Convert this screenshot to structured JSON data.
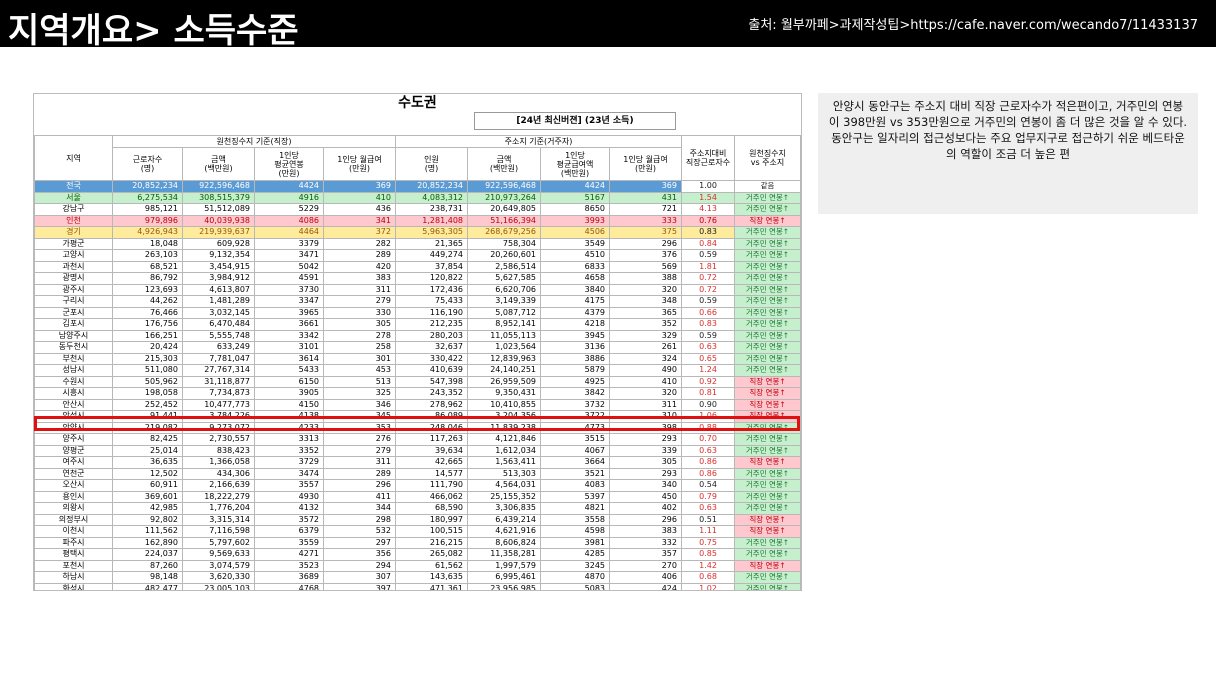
{
  "header": {
    "title": "지역개요> 소득수준",
    "source": "출처: 월부까페>과제작성팁>https://cafe.naver.com/wecando7/11433137"
  },
  "sheet": {
    "title": "수도권",
    "badge": "[24년 최신버젼] (23년 소득)",
    "group_withholding": "원천징수지 기준(직장)",
    "group_address": "주소지 기준(거주자)",
    "col_region": "지역",
    "col_workers": "근로자수\n(명)",
    "col_amount": "금액\n(백만원)",
    "col_avg": "1인당\n평균연봉\n(만원)",
    "col_monthly": "1인당 월급여\n(만원)",
    "col_people": "인원\n(명)",
    "col_amount2": "금액\n(백만원)",
    "col_avg2": "1인당\n평균급여액\n(백만원)",
    "col_monthly2": "1인당 월급여\n(만원)",
    "col_ratio": "주소지대비\n직장근로자수",
    "col_judge": "원천징수지\nvs 주소지"
  },
  "colors": {
    "blue": "#5b9bd5",
    "green": "#c6efce",
    "red": "#ffc7ce",
    "yellow": "#ffeb9c",
    "red_text": "#d9302c",
    "green_text": "#1e7a33",
    "red_text2": "#c0000a"
  },
  "rows": [
    [
      "전국",
      "20,852,234",
      "922,596,468",
      "4424",
      "369",
      "20,852,234",
      "922,596,468",
      "4424",
      "369",
      "1.00",
      "같음",
      "blue"
    ],
    [
      "서울",
      "6,275,534",
      "308,515,379",
      "4916",
      "410",
      "4,083,312",
      "210,973,264",
      "5167",
      "431",
      "1.54",
      "거주민 연봉↑",
      "green"
    ],
    [
      "강남구",
      "985,121",
      "51,512,089",
      "5229",
      "436",
      "238,731",
      "20,649,805",
      "8650",
      "721",
      "4.13",
      "거주민 연봉↑",
      ""
    ],
    [
      "인천",
      "979,896",
      "40,039,938",
      "4086",
      "341",
      "1,281,408",
      "51,166,394",
      "3993",
      "333",
      "0.76",
      "직장 연봉↑",
      "red"
    ],
    [
      "경기",
      "4,926,943",
      "219,939,637",
      "4464",
      "372",
      "5,963,305",
      "268,679,256",
      "4506",
      "375",
      "0.83",
      "거주민 연봉↑",
      "yellow"
    ],
    [
      "가평군",
      "18,048",
      "609,928",
      "3379",
      "282",
      "21,365",
      "758,304",
      "3549",
      "296",
      "0.84",
      "거주민 연봉↑",
      ""
    ],
    [
      "고양시",
      "263,103",
      "9,132,354",
      "3471",
      "289",
      "449,274",
      "20,260,601",
      "4510",
      "376",
      "0.59",
      "거주민 연봉↑",
      ""
    ],
    [
      "과천시",
      "68,521",
      "3,454,915",
      "5042",
      "420",
      "37,854",
      "2,586,514",
      "6833",
      "569",
      "1.81",
      "거주민 연봉↑",
      ""
    ],
    [
      "광명시",
      "86,792",
      "3,984,912",
      "4591",
      "383",
      "120,822",
      "5,627,585",
      "4658",
      "388",
      "0.72",
      "거주민 연봉↑",
      ""
    ],
    [
      "광주시",
      "123,693",
      "4,613,807",
      "3730",
      "311",
      "172,436",
      "6,620,706",
      "3840",
      "320",
      "0.72",
      "거주민 연봉↑",
      ""
    ],
    [
      "구리시",
      "44,262",
      "1,481,289",
      "3347",
      "279",
      "75,433",
      "3,149,339",
      "4175",
      "348",
      "0.59",
      "거주민 연봉↑",
      ""
    ],
    [
      "군포시",
      "76,466",
      "3,032,145",
      "3965",
      "330",
      "116,190",
      "5,087,712",
      "4379",
      "365",
      "0.66",
      "거주민 연봉↑",
      ""
    ],
    [
      "김포시",
      "176,756",
      "6,470,484",
      "3661",
      "305",
      "212,235",
      "8,952,141",
      "4218",
      "352",
      "0.83",
      "거주민 연봉↑",
      ""
    ],
    [
      "남양주시",
      "166,251",
      "5,555,748",
      "3342",
      "278",
      "280,203",
      "11,055,113",
      "3945",
      "329",
      "0.59",
      "거주민 연봉↑",
      ""
    ],
    [
      "동두천시",
      "20,424",
      "633,249",
      "3101",
      "258",
      "32,637",
      "1,023,564",
      "3136",
      "261",
      "0.63",
      "거주민 연봉↑",
      ""
    ],
    [
      "부천시",
      "215,303",
      "7,781,047",
      "3614",
      "301",
      "330,422",
      "12,839,963",
      "3886",
      "324",
      "0.65",
      "거주민 연봉↑",
      ""
    ],
    [
      "성남시",
      "511,080",
      "27,767,314",
      "5433",
      "453",
      "410,639",
      "24,140,251",
      "5879",
      "490",
      "1.24",
      "거주민 연봉↑",
      ""
    ],
    [
      "수원시",
      "505,962",
      "31,118,877",
      "6150",
      "513",
      "547,398",
      "26,959,509",
      "4925",
      "410",
      "0.92",
      "직장 연봉↑",
      ""
    ],
    [
      "시흥시",
      "198,058",
      "7,734,873",
      "3905",
      "325",
      "243,352",
      "9,350,431",
      "3842",
      "320",
      "0.81",
      "직장 연봉↑",
      ""
    ],
    [
      "안산시",
      "252,452",
      "10,477,773",
      "4150",
      "346",
      "278,962",
      "10,410,855",
      "3732",
      "311",
      "0.90",
      "직장 연봉↑",
      ""
    ],
    [
      "안성시",
      "91,441",
      "3,784,226",
      "4138",
      "345",
      "86,089",
      "3,204,356",
      "3722",
      "310",
      "1.06",
      "직장 연봉↑",
      ""
    ],
    [
      "안양시",
      "219,082",
      "9,273,072",
      "4233",
      "353",
      "248,046",
      "11,839,238",
      "4773",
      "398",
      "0.88",
      "거주민 연봉↑",
      ""
    ],
    [
      "양주시",
      "82,425",
      "2,730,557",
      "3313",
      "276",
      "117,263",
      "4,121,846",
      "3515",
      "293",
      "0.70",
      "거주민 연봉↑",
      ""
    ],
    [
      "양평군",
      "25,014",
      "838,423",
      "3352",
      "279",
      "39,634",
      "1,612,034",
      "4067",
      "339",
      "0.63",
      "거주민 연봉↑",
      ""
    ],
    [
      "여주시",
      "36,635",
      "1,366,058",
      "3729",
      "311",
      "42,665",
      "1,563,411",
      "3664",
      "305",
      "0.86",
      "직장 연봉↑",
      ""
    ],
    [
      "연천군",
      "12,502",
      "434,306",
      "3474",
      "289",
      "14,577",
      "513,303",
      "3521",
      "293",
      "0.86",
      "거주민 연봉↑",
      ""
    ],
    [
      "오산시",
      "60,911",
      "2,166,639",
      "3557",
      "296",
      "111,790",
      "4,564,031",
      "4083",
      "340",
      "0.54",
      "거주민 연봉↑",
      ""
    ],
    [
      "용인시",
      "369,601",
      "18,222,279",
      "4930",
      "411",
      "466,062",
      "25,155,352",
      "5397",
      "450",
      "0.79",
      "거주민 연봉↑",
      ""
    ],
    [
      "의왕시",
      "42,985",
      "1,776,204",
      "4132",
      "344",
      "68,590",
      "3,306,835",
      "4821",
      "402",
      "0.63",
      "거주민 연봉↑",
      ""
    ],
    [
      "의정부시",
      "92,802",
      "3,315,314",
      "3572",
      "298",
      "180,997",
      "6,439,214",
      "3558",
      "296",
      "0.51",
      "직장 연봉↑",
      ""
    ],
    [
      "이천시",
      "111,562",
      "7,116,598",
      "6379",
      "532",
      "100,515",
      "4,621,916",
      "4598",
      "383",
      "1.11",
      "직장 연봉↑",
      ""
    ],
    [
      "파주시",
      "162,890",
      "5,797,602",
      "3559",
      "297",
      "216,215",
      "8,606,824",
      "3981",
      "332",
      "0.75",
      "거주민 연봉↑",
      ""
    ],
    [
      "평택시",
      "224,037",
      "9,569,633",
      "4271",
      "356",
      "265,082",
      "11,358,281",
      "4285",
      "357",
      "0.85",
      "거주민 연봉↑",
      ""
    ],
    [
      "포천시",
      "87,260",
      "3,074,579",
      "3523",
      "294",
      "61,562",
      "1,997,579",
      "3245",
      "270",
      "1.42",
      "직장 연봉↑",
      ""
    ],
    [
      "하남시",
      "98,148",
      "3,620,330",
      "3689",
      "307",
      "143,635",
      "6,995,461",
      "4870",
      "406",
      "0.68",
      "거주민 연봉↑",
      ""
    ],
    [
      "화성시",
      "482,477",
      "23,005,103",
      "4768",
      "397",
      "471,361",
      "23,956,985",
      "5083",
      "424",
      "1.02",
      "거주민 연봉↑",
      ""
    ]
  ],
  "note": {
    "line1": "안양시 동안구는 주소지 대비 직장 근로자수가 적은편이고, 거주민의 연봉이 398만원 vs 353만원으로 거주민의 연봉이 좀 더 많은 것을 알 수 있다.",
    "line2": "동안구는 일자리의 접근성보다는 주요 업무지구로 접근하기 쉬운 베드타운의 역할이 조금 더 높은 편"
  }
}
